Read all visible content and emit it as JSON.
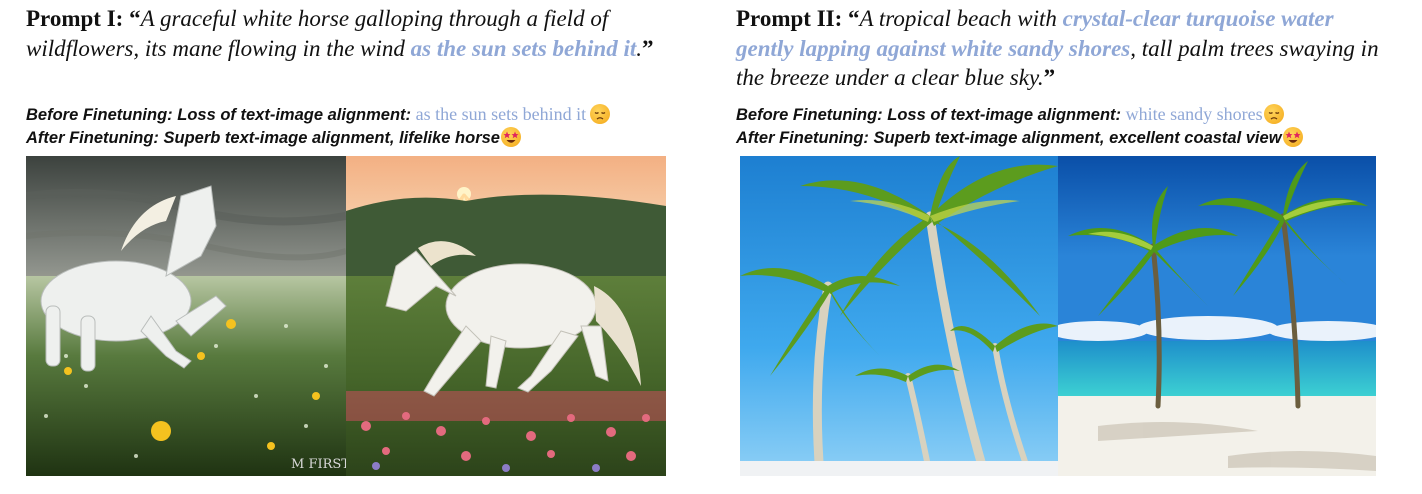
{
  "panel1": {
    "prompt_label": "Prompt I:",
    "open_quote": "“",
    "prompt_text": "A graceful white horse galloping through a field of wildflowers, its mane flowing in the wind",
    "prompt_highlight": "as the sun sets behind it",
    "prompt_end": ".",
    "close_quote": "”",
    "before_label": "Before Finetuning: Loss of text-image alignment:",
    "before_highlight": "as the sun sets behind it",
    "before_emoji": "disappointed-face-emoji",
    "after_label": "After Finetuning: Superb text-image alignment, lifelike horse",
    "after_emoji": "star-struck-face-emoji",
    "image_before_signature": "M FIRST",
    "image_before": "horse-before-image",
    "image_after": "horse-after-image"
  },
  "panel2": {
    "prompt_label": "Prompt II:",
    "open_quote": "“",
    "prompt_text_a": "A tropical beach with",
    "prompt_highlight": "crystal-clear turquoise water gently lapping against white sandy shores",
    "prompt_text_b": ", tall palm trees swaying in the breeze under a clear blue sky.",
    "close_quote": "”",
    "before_label": "Before Finetuning: Loss of text-image alignment:",
    "before_highlight": "white sandy shores",
    "before_emoji": "disappointed-face-emoji",
    "after_label": "After Finetuning: Superb text-image alignment, excellent coastal view",
    "after_emoji": "star-struck-face-emoji",
    "image_before": "palm-before-image",
    "image_after": "beach-after-image"
  },
  "colors": {
    "highlight": "#8fa7d6",
    "text": "#111111"
  }
}
